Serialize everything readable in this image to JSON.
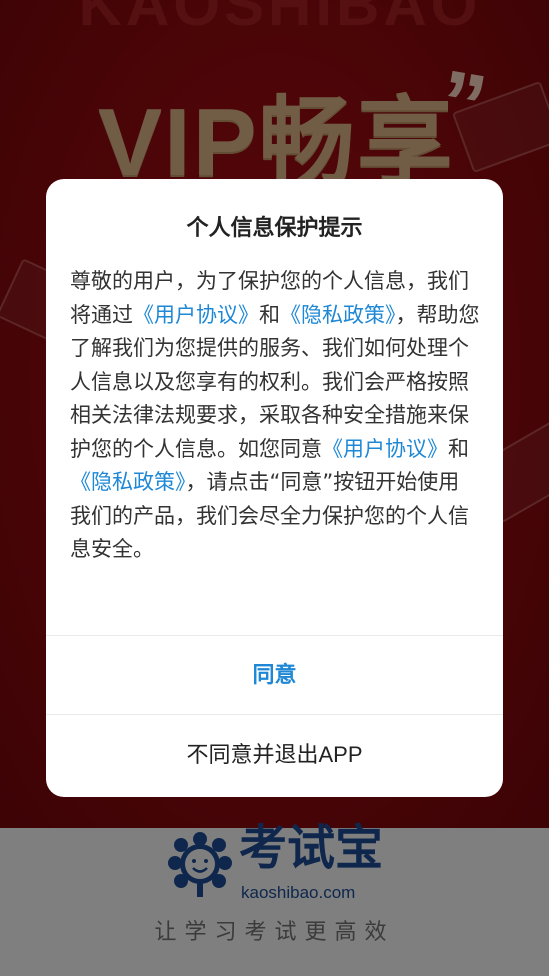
{
  "background": {
    "brand_strip": "KAOSHIBAO",
    "promo_text": "VIP畅享",
    "quote_mark": "”",
    "logo_title": "考试宝",
    "logo_domain": "kaoshibao.com",
    "slogan": "让学习考试更高效"
  },
  "dialog": {
    "title": "个人信息保护提示",
    "body": {
      "part1": "尊敬的用户，为了保护您的个人信息，我们将通过",
      "link1": "《用户协议》",
      "part2": "和",
      "link2": "《隐私政策》",
      "part3": "，帮助您了解我们为您提供的服务、我们如何处理个人信息以及您享有的权利。我们会严格按照相关法律法规要求，采取各种安全措施来保护您的个人信息。如您同意",
      "link3": "《用户协议》",
      "part4": "和",
      "link4": "《隐私政策》",
      "part5": "，请点击“同意”按钮开始使用我们的产品，我们会尽全力保护您的个人信息安全。"
    },
    "agree_label": "同意",
    "disagree_label": "不同意并退出APP"
  },
  "colors": {
    "brand_red": "#9a0b10",
    "link_blue": "#1e88d6",
    "logo_blue": "#1e4f9b"
  }
}
